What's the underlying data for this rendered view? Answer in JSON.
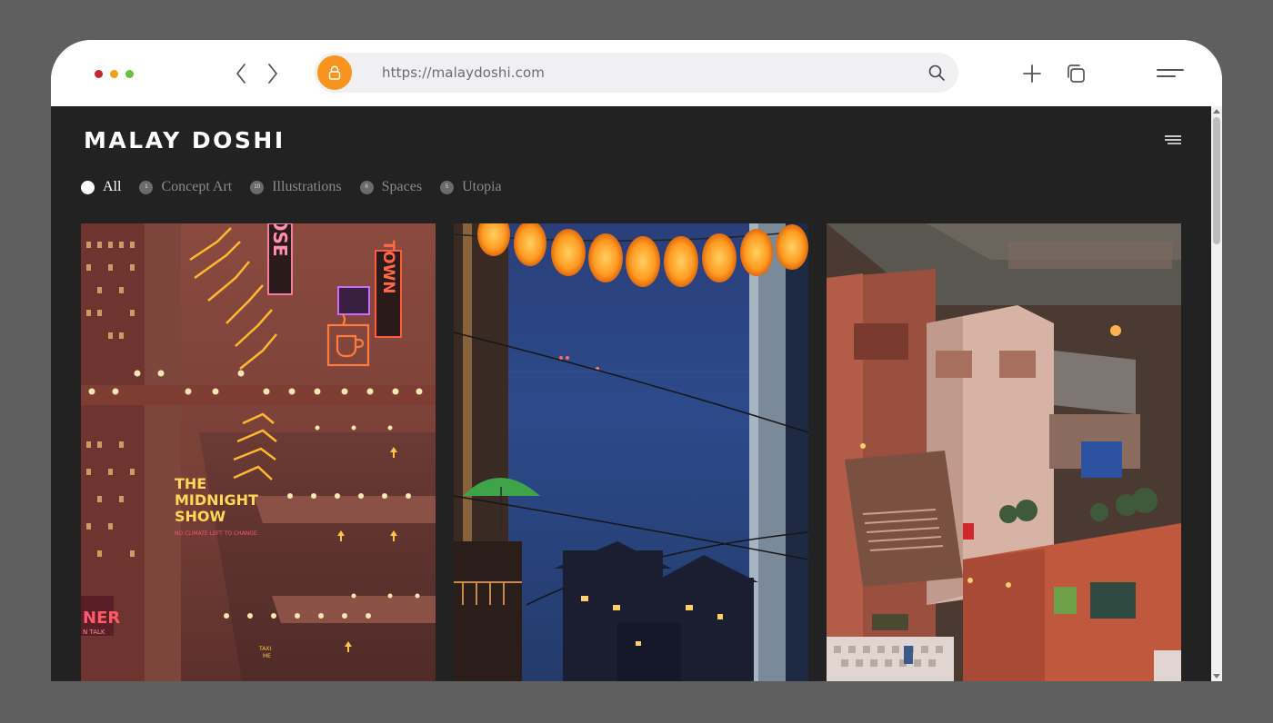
{
  "browser": {
    "url": "https://malaydoshi.com",
    "traffic_lights": [
      "#c0282d",
      "#f0a019",
      "#66c23a"
    ],
    "accent": "#f7941d"
  },
  "site": {
    "title": "MALAY DOSHI",
    "filters": [
      {
        "label": "All",
        "count": "",
        "active": true
      },
      {
        "label": "Concept Art",
        "count": "1",
        "active": false
      },
      {
        "label": "Illustrations",
        "count": "10",
        "active": false
      },
      {
        "label": "Spaces",
        "count": "6",
        "active": false
      },
      {
        "label": "Utopia",
        "count": "5",
        "active": false
      }
    ],
    "cards": [
      {
        "name": "midnight-show",
        "signs": {
          "show_title_1": "THE",
          "show_title_2": "MIDNIGHT",
          "show_title_3": "SHOW",
          "show_tagline": "NO CLIMATE LEFT TO CHANGE",
          "vertical_sign": "OSE",
          "town_sign": "TOWN",
          "left_sign_1": "NER",
          "left_sign_2": "N TALK",
          "road_marking_1": "TAXI",
          "road_marking_2": "ME"
        }
      },
      {
        "name": "lanterns-harbor"
      },
      {
        "name": "terracotta-rooftops"
      }
    ]
  }
}
